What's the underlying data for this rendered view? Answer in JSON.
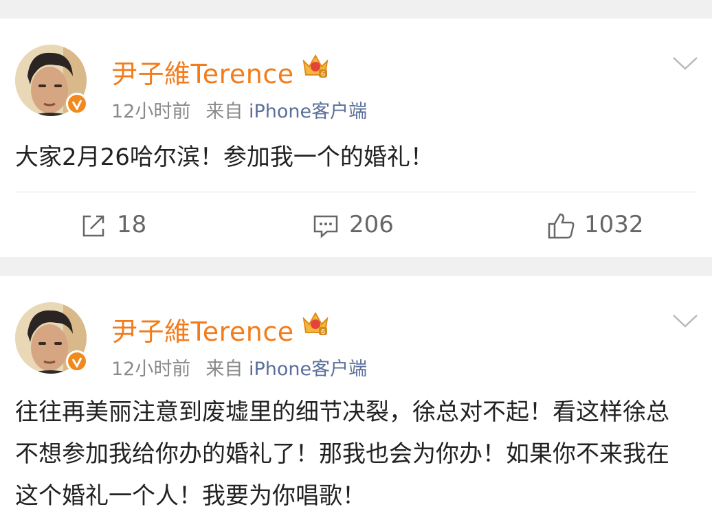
{
  "posts": [
    {
      "username": "尹子維Terence",
      "time": "12小时前",
      "source_prefix": "来自",
      "source": "iPhone客户端",
      "content": "大家2月26哈尔滨！参加我一个的婚礼！",
      "reposts": "18",
      "comments": "206",
      "likes": "1032"
    },
    {
      "username": "尹子維Terence",
      "time": "12小时前",
      "source_prefix": "来自",
      "source": "iPhone客户端",
      "content": "往往再美丽注意到废墟里的细节决裂，徐总对不起！看这样徐总不想参加我给你办的婚礼了！那我也会为你办！如果你不来我在这个婚礼一个人！我要为你唱歌！"
    }
  ],
  "colors": {
    "username": "#f27c1b",
    "source": "#5a6f9a",
    "verified": "#f08a1e",
    "text": "#222222",
    "meta": "#8a8a8a"
  },
  "icons": [
    "verified-badge-icon",
    "crown-icon",
    "chevron-down-icon",
    "repost-icon",
    "comment-icon",
    "like-icon"
  ]
}
